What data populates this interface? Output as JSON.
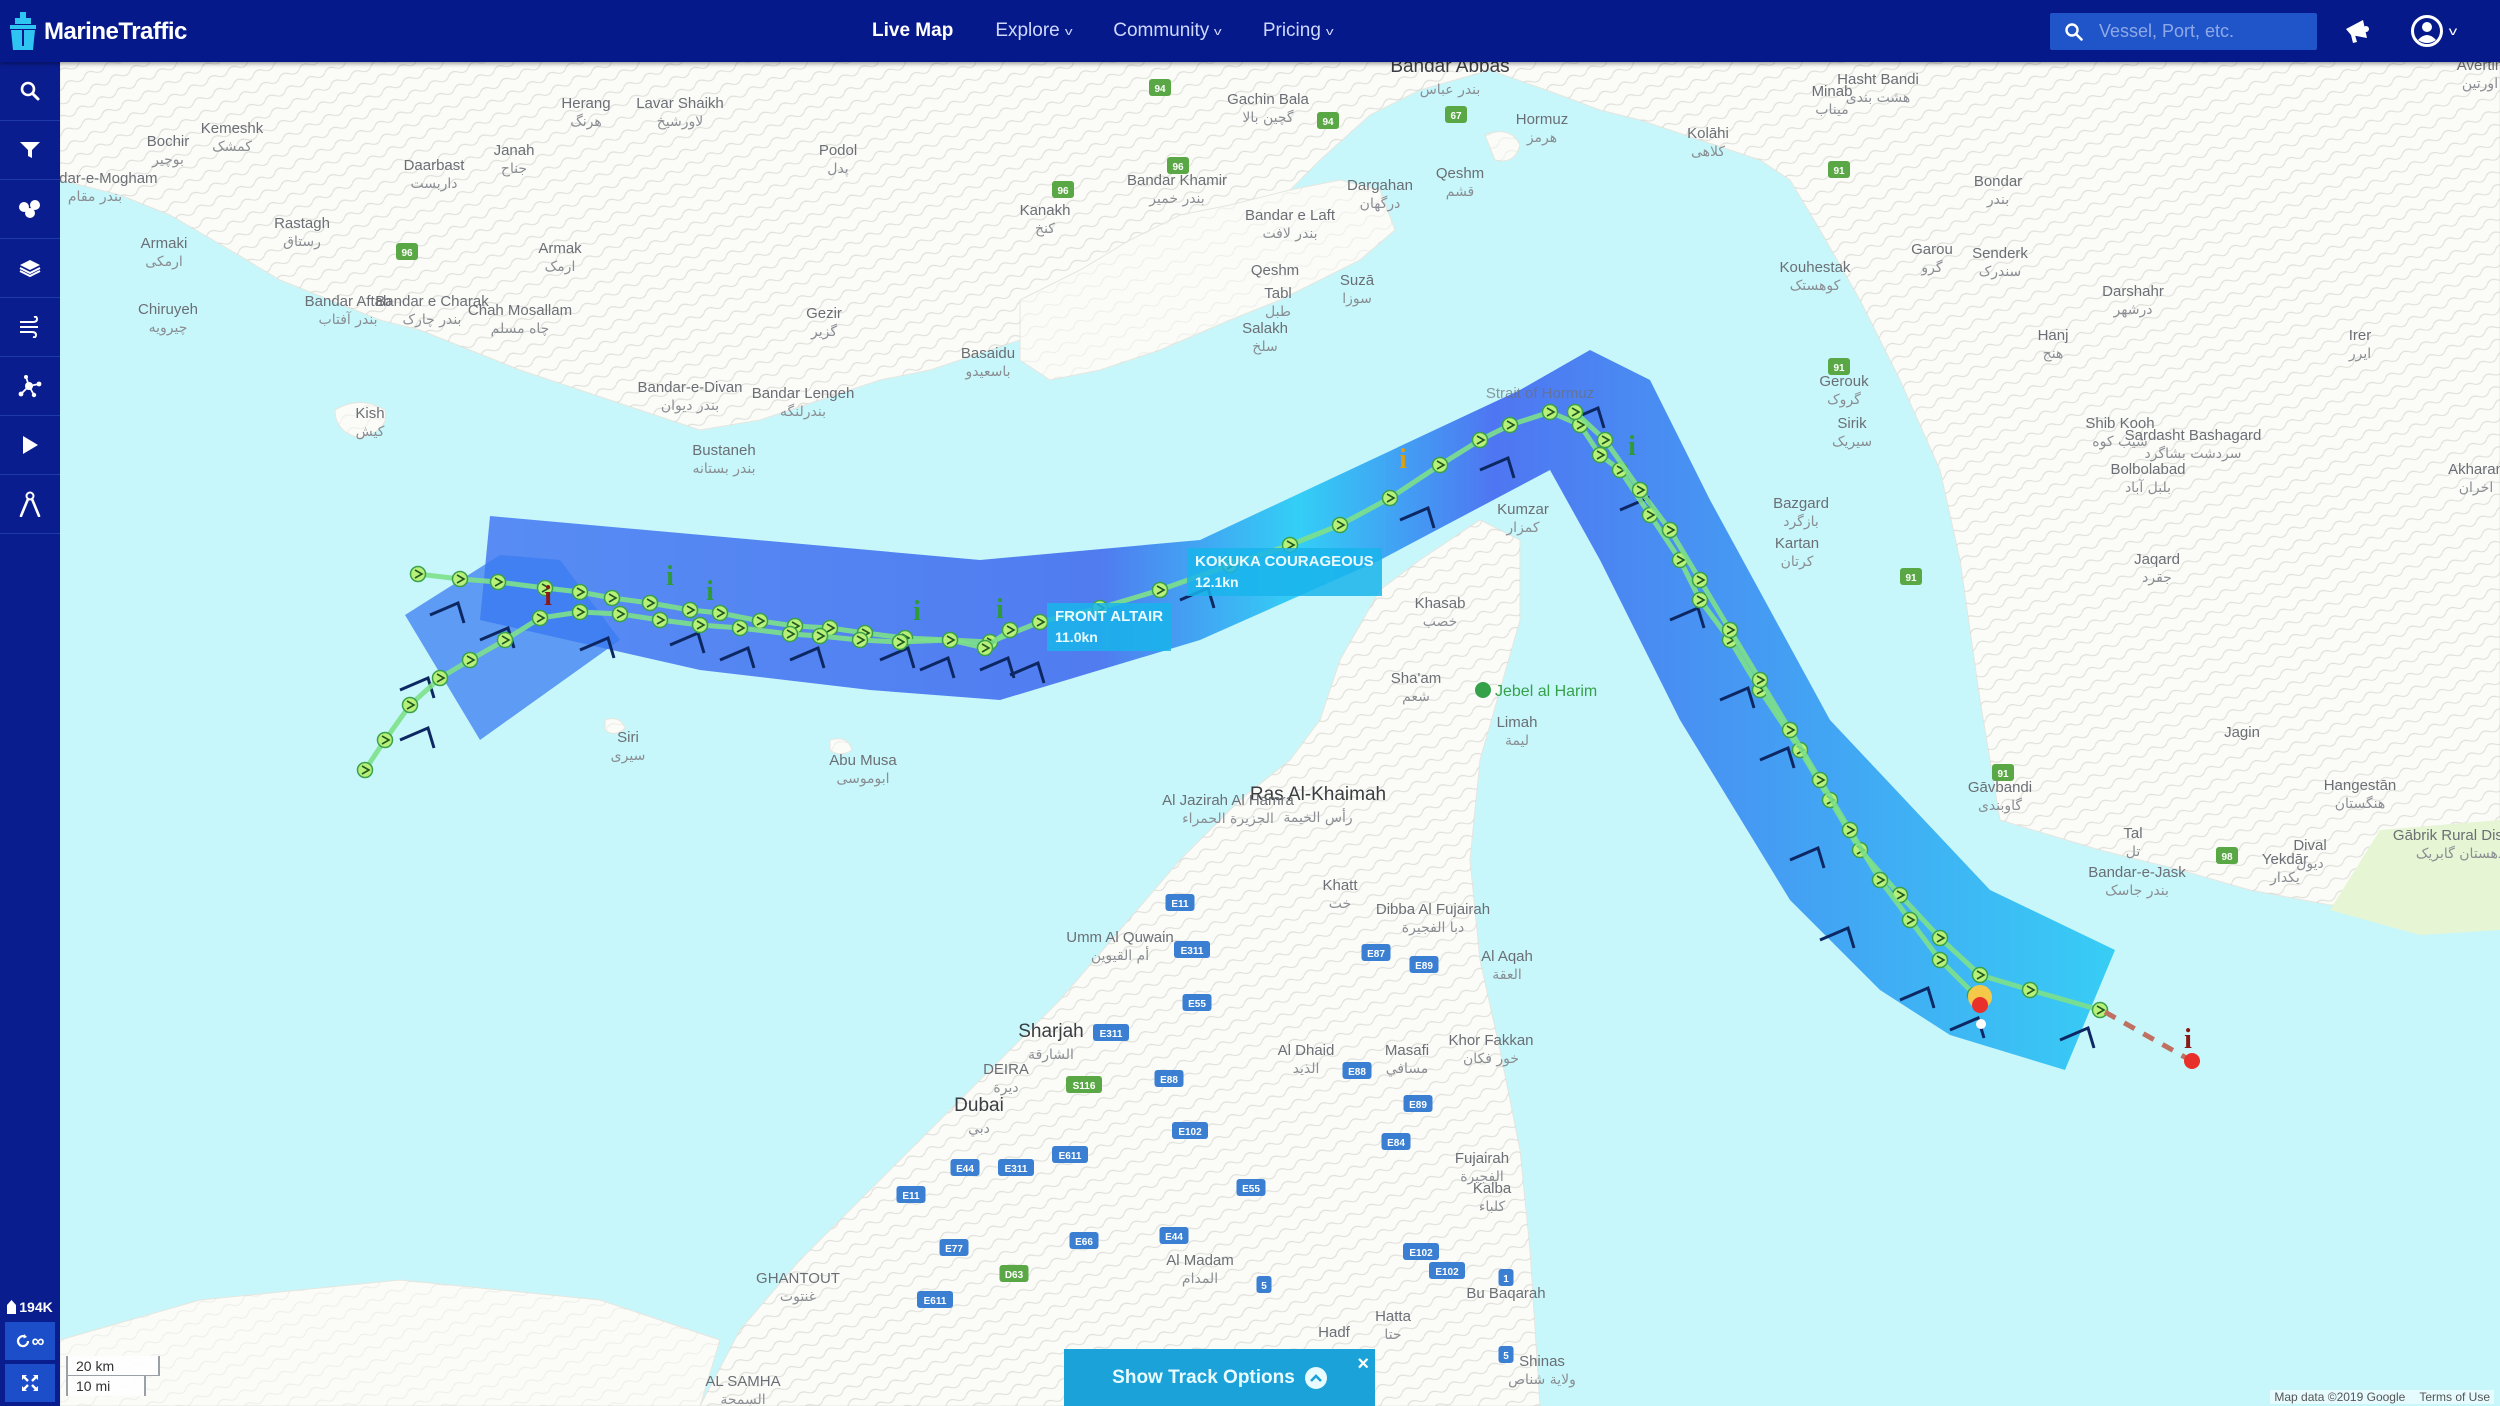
{
  "app": {
    "name": "MarineTraffic"
  },
  "header": {
    "nav": [
      {
        "label": "Live Map",
        "active": true,
        "dropdown": false
      },
      {
        "label": "Explore",
        "active": false,
        "dropdown": true
      },
      {
        "label": "Community",
        "active": false,
        "dropdown": true
      },
      {
        "label": "Pricing",
        "active": false,
        "dropdown": true
      }
    ],
    "search": {
      "placeholder": "Vessel, Port, etc.",
      "value": ""
    },
    "icons": {
      "announcements": "megaphone-icon",
      "account": "user-circle-icon"
    }
  },
  "sidebar": {
    "items": [
      {
        "name": "search",
        "icon": "search-icon"
      },
      {
        "name": "filters",
        "icon": "filter-icon"
      },
      {
        "name": "fleets",
        "icon": "fleet-icon"
      },
      {
        "name": "layers",
        "icon": "layers-icon"
      },
      {
        "name": "weather",
        "icon": "wind-icon"
      },
      {
        "name": "density",
        "icon": "network-icon"
      },
      {
        "name": "playback",
        "icon": "play-icon"
      },
      {
        "name": "measure",
        "icon": "compass-icon"
      }
    ],
    "vessel_count": "194K",
    "track_time": "∞",
    "fullscreen_icon": "expand-icon"
  },
  "vessels": [
    {
      "name": "FRONT ALTAIR",
      "speed": "11.0kn"
    },
    {
      "name": "KOKUKA COURAGEOUS",
      "speed": "12.1kn"
    }
  ],
  "map": {
    "colors": {
      "sea": "#c7f7fb",
      "land": "#fbfbf8",
      "track": "#7de08a",
      "track_point": "#b9f07a",
      "danger": "#e8312b",
      "corridor": "#3a6cf0"
    },
    "places": [
      {
        "en": "Bandar Abbas",
        "ar": "بندر عباس"
      },
      {
        "en": "Gachin Bala",
        "ar": "گچین بالا"
      },
      {
        "en": "Hormuz",
        "ar": "هرمز"
      },
      {
        "en": "Minab",
        "ar": "میناب"
      },
      {
        "en": "Kolāhi",
        "ar": "کلاهی"
      },
      {
        "en": "Hasht Bandi",
        "ar": "هشت بندی"
      },
      {
        "en": "Bondar",
        "ar": "بندر"
      },
      {
        "en": "Garou",
        "ar": "گرو"
      },
      {
        "en": "Senderk",
        "ar": "سندرک"
      },
      {
        "en": "Kouhestak",
        "ar": "کوهستک"
      },
      {
        "en": "Darshahr",
        "ar": "درشهر"
      },
      {
        "en": "Hanj",
        "ar": "هنج"
      },
      {
        "en": "Irer",
        "ar": "ایرر"
      },
      {
        "en": "Avertin",
        "ar": "اورتین"
      },
      {
        "en": "Gerouk",
        "ar": "گروک"
      },
      {
        "en": "Sirik",
        "ar": "سیریک"
      },
      {
        "en": "Shib Kooh",
        "ar": "شیب کوه"
      },
      {
        "en": "Sardasht Bashagard",
        "ar": "سردشت بشاگرد"
      },
      {
        "en": "Bolbolabad",
        "ar": "بلبل آباد"
      },
      {
        "en": "Akharan",
        "ar": "اخران"
      },
      {
        "en": "Bazgard",
        "ar": "بازگرد"
      },
      {
        "en": "Kartan",
        "ar": "کرتان"
      },
      {
        "en": "Jaqard",
        "ar": "جقرد"
      },
      {
        "en": "Jagin",
        "ar": ""
      },
      {
        "en": "Gāvbandi",
        "ar": "گاوبندی"
      },
      {
        "en": "Hangestān",
        "ar": "هنگستان"
      },
      {
        "en": "Tal",
        "ar": "تل"
      },
      {
        "en": "Bandar-e-Jask",
        "ar": "بندر جاسک"
      },
      {
        "en": "Yekdār",
        "ar": "یکدار"
      },
      {
        "en": "Dival",
        "ar": "دیول"
      },
      {
        "en": "Gābrik Rural District",
        "ar": "دهستان گابریک"
      },
      {
        "en": "Bochir",
        "ar": "بوچیر"
      },
      {
        "en": "Kemeshk",
        "ar": "کمشک"
      },
      {
        "en": "Herang",
        "ar": "هرنگ"
      },
      {
        "en": "Lavar Shaikh",
        "ar": "لاورشیخ"
      },
      {
        "en": "Janah",
        "ar": "جناح"
      },
      {
        "en": "Podol",
        "ar": "پدل"
      },
      {
        "en": "Daarbast",
        "ar": "داربست"
      },
      {
        "en": "Bandar-e-Mogham",
        "ar": "بندر مقام"
      },
      {
        "en": "Rastagh",
        "ar": "رستاق"
      },
      {
        "en": "Armaki",
        "ar": "ارمکی"
      },
      {
        "en": "Armak",
        "ar": "ارمک"
      },
      {
        "en": "Chiruyeh",
        "ar": "چیرویه"
      },
      {
        "en": "Bandar Aftab",
        "ar": "بندر آفتاب"
      },
      {
        "en": "Bandar e Charak",
        "ar": "بندر چارک"
      },
      {
        "en": "Chah Mosallam",
        "ar": "چاه مسلم"
      },
      {
        "en": "Gezir",
        "ar": "گزیر"
      },
      {
        "en": "Bandar-e-Divan",
        "ar": "بندر دیوان"
      },
      {
        "en": "Bustaneh",
        "ar": "بندر بستانه"
      },
      {
        "en": "Bandar Lengeh",
        "ar": "بندرلنگه"
      },
      {
        "en": "Kish",
        "ar": "کیش"
      },
      {
        "en": "Bandar Khamir",
        "ar": "بندر خمیر"
      },
      {
        "en": "Kanakh",
        "ar": "کنخ"
      },
      {
        "en": "Bandar e Laft",
        "ar": "بندر لافت"
      },
      {
        "en": "Dargahan",
        "ar": "درگهان"
      },
      {
        "en": "Qeshm",
        "ar": "قشم"
      },
      {
        "en": "Qeshm",
        "ar": ""
      },
      {
        "en": "Suzā",
        "ar": "سوزا"
      },
      {
        "en": "Tabl",
        "ar": "طبل"
      },
      {
        "en": "Salakh",
        "ar": "سلخ"
      },
      {
        "en": "Basaidu",
        "ar": "باسعیدو"
      },
      {
        "en": "Strait of Hormuz",
        "ar": ""
      },
      {
        "en": "Kumzar",
        "ar": "كمزار"
      },
      {
        "en": "Khasab",
        "ar": "خصب"
      },
      {
        "en": "Sha'am",
        "ar": "شعم"
      },
      {
        "en": "Limah",
        "ar": "ليمة"
      },
      {
        "en": "Siri",
        "ar": "سیری"
      },
      {
        "en": "Abu Musa",
        "ar": "ابوموسی"
      },
      {
        "en": "Ras Al-Khaimah",
        "ar": "رأس الخيمة"
      },
      {
        "en": "Al Jazirah Al Hamra",
        "ar": "الجزيرة الحمراء"
      },
      {
        "en": "Khatt",
        "ar": "خت"
      },
      {
        "en": "Dibba Al Fujairah",
        "ar": "دبا الفجيرة"
      },
      {
        "en": "Umm Al Quwain",
        "ar": "أم القيوين"
      },
      {
        "en": "Al Aqah",
        "ar": "العقة"
      },
      {
        "en": "Sharjah",
        "ar": "الشارقة"
      },
      {
        "en": "DEIRA",
        "ar": "ديرة"
      },
      {
        "en": "Al Dhaid",
        "ar": "الذيد"
      },
      {
        "en": "Masafi",
        "ar": "مسافي"
      },
      {
        "en": "Khor Fakkan",
        "ar": "خور فكان"
      },
      {
        "en": "Dubai",
        "ar": "دبي"
      },
      {
        "en": "Fujairah",
        "ar": "الفجيرة"
      },
      {
        "en": "Kalba",
        "ar": "كلباء"
      },
      {
        "en": "Al Madam",
        "ar": "المدام"
      },
      {
        "en": "Bu Baqarah",
        "ar": ""
      },
      {
        "en": "GHANTOUT",
        "ar": "غنتوت"
      },
      {
        "en": "Hatta",
        "ar": "حتا"
      },
      {
        "en": "Hadf",
        "ar": ""
      },
      {
        "en": "Shinas",
        "ar": "ولاية شناص"
      },
      {
        "en": "AL SAMHA",
        "ar": "السمحة"
      },
      {
        "en": "Jebel al Harim",
        "ar": ""
      }
    ],
    "roads": [
      "94",
      "94",
      "96",
      "96",
      "96",
      "67",
      "91",
      "91",
      "91",
      "91",
      "98",
      "E11",
      "E311",
      "E55",
      "E311",
      "S116",
      "E88",
      "E87",
      "E89",
      "E88",
      "E89",
      "E84",
      "E102",
      "E611",
      "E44",
      "E311",
      "E11",
      "E55",
      "E77",
      "E66",
      "E44",
      "D63",
      "E611",
      "E102",
      "E102",
      "1",
      "5",
      "5"
    ],
    "attribution": "Map data ©2019 Google",
    "terms": "Terms of Use",
    "scale": {
      "metric": "20 km",
      "imperial": "10 mi"
    }
  },
  "track_options": {
    "label": "Show Track Options",
    "close": "×"
  }
}
